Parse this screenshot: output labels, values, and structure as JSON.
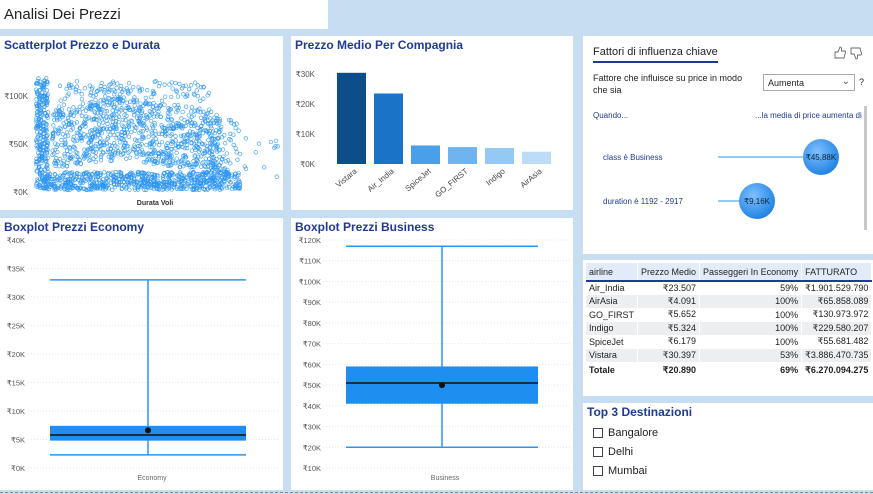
{
  "header": {
    "title": "Analisi Dei Prezzi"
  },
  "scatter": {
    "title": "Scatterplot Prezzo e Durata",
    "xlabel": "Durata Voli",
    "y_ticks": [
      "₹100K",
      "₹50K",
      "₹0K"
    ]
  },
  "bar": {
    "title": "Prezzo Medio Per Compagnia",
    "y_ticks": [
      "₹30K",
      "₹20K",
      "₹10K",
      "₹0K"
    ]
  },
  "economy": {
    "title": "Boxplot Prezzi Economy",
    "y_ticks": [
      "₹40K",
      "₹35K",
      "₹30K",
      "₹25K",
      "₹20K",
      "₹15K",
      "₹10K",
      "₹5K",
      "₹0K"
    ],
    "xlabel": "Economy"
  },
  "business": {
    "title": "Boxplot Prezzi Business",
    "y_ticks": [
      "₹120K",
      "₹110K",
      "₹100K",
      "₹90K",
      "₹80K",
      "₹70K",
      "₹60K",
      "₹50K",
      "₹40K",
      "₹30K",
      "₹20K",
      "₹10K"
    ],
    "xlabel": "Business"
  },
  "influencers": {
    "tab": "Fattori di influenza chiave",
    "question": "Fattore che influisce su price in modo che sia",
    "dropdown_value": "Aumenta",
    "help": "?",
    "when_label": "Quando...",
    "avg_label": "...la media di price aumenta di",
    "rows": [
      {
        "label": "class è Business",
        "value": "₹45,88K"
      },
      {
        "label": "duration è 1192 - 2917",
        "value": "₹9,16K"
      }
    ],
    "icons": [
      "thumbs-up-icon",
      "thumbs-down-icon",
      "chevron-down-icon"
    ]
  },
  "table": {
    "headers": [
      "airline",
      "Prezzo Medio",
      "Passeggeri In Economy",
      "FATTURATO"
    ],
    "rows": [
      [
        "Air_India",
        "₹23.507",
        "59%",
        "₹1.901.529.790"
      ],
      [
        "AirAsia",
        "₹4.091",
        "100%",
        "₹65.858.089"
      ],
      [
        "GO_FIRST",
        "₹5.652",
        "100%",
        "₹130.973.972"
      ],
      [
        "Indigo",
        "₹5.324",
        "100%",
        "₹229.580.207"
      ],
      [
        "SpiceJet",
        "₹6.179",
        "100%",
        "₹55.681.482"
      ],
      [
        "Vistara",
        "₹30.397",
        "53%",
        "₹3.886.470.735"
      ]
    ],
    "total": [
      "Totale",
      "₹20.890",
      "69%",
      "₹6.270.094.275"
    ]
  },
  "destinations": {
    "title": "Top 3 Destinazioni",
    "items": [
      "Bangalore",
      "Delhi",
      "Mumbai"
    ]
  },
  "chart_data": [
    {
      "type": "bar",
      "title": "Prezzo Medio Per Compagnia",
      "categories": [
        "Vistara",
        "Air_India",
        "SpiceJet",
        "GO_FIRST",
        "Indigo",
        "AirAsia"
      ],
      "values": [
        30397,
        23507,
        6179,
        5652,
        5324,
        4091
      ],
      "colors": [
        "#0f4c8a",
        "#1a73c7",
        "#4aa0e8",
        "#6fb4ee",
        "#94c9f3",
        "#bcdcf7"
      ],
      "ylim": [
        0,
        35000
      ],
      "xlabel": "",
      "ylabel": ""
    },
    {
      "type": "scatter",
      "title": "Scatterplot Prezzo e Durata",
      "xlabel": "Durata Voli",
      "ylim": [
        0,
        130000
      ],
      "color": "#2b95f3"
    },
    {
      "type": "box",
      "title": "Boxplot Prezzi Economy",
      "category": "Economy",
      "whisker_low": 2300,
      "q1": 4800,
      "median": 5800,
      "q3": 7400,
      "whisker_high": 33000,
      "mean": 6600,
      "ylim": [
        0,
        40000
      ]
    },
    {
      "type": "box",
      "title": "Boxplot Prezzi Business",
      "category": "Business",
      "whisker_low": 20000,
      "q1": 41000,
      "median": 51000,
      "q3": 59000,
      "whisker_high": 117000,
      "mean": 50000,
      "ylim": [
        10000,
        120000
      ]
    }
  ]
}
